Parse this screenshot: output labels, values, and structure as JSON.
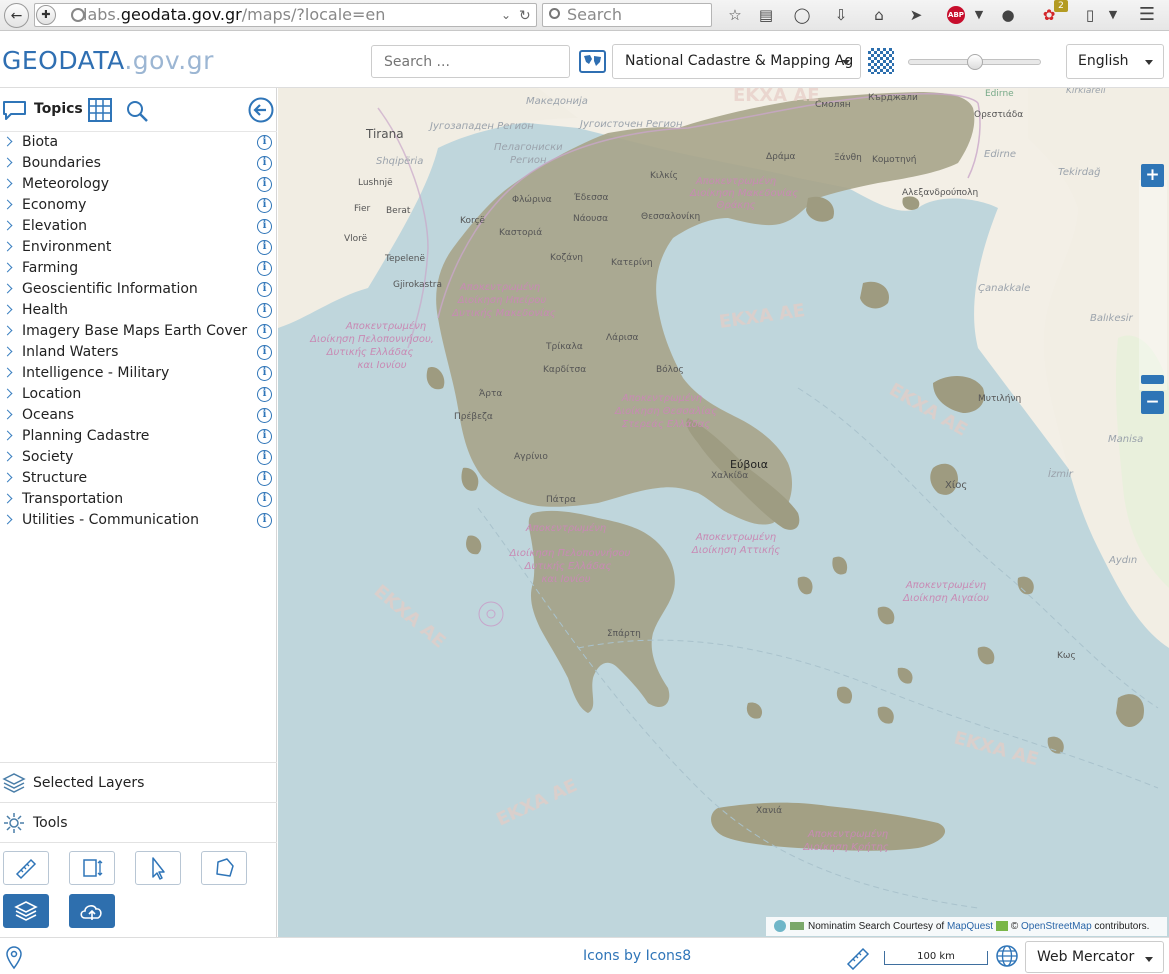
{
  "browser": {
    "url_prefix": "labs.",
    "url_domain": "geodata.gov.gr",
    "url_path": "/maps/?locale=en",
    "search_placeholder": "Search",
    "addon_badge": "2",
    "abp_label": "ABP"
  },
  "header": {
    "logo_brand": "GEODATA",
    "logo_suffix": ".gov.gr",
    "search_placeholder": "Search ...",
    "provider_selected": "National Cadastre & Mapping Ag",
    "opacity_percent": 50,
    "language_selected": "English"
  },
  "sidebar": {
    "title": "Topics",
    "topics": [
      {
        "label": "Biota"
      },
      {
        "label": "Boundaries"
      },
      {
        "label": "Meteorology"
      },
      {
        "label": "Economy"
      },
      {
        "label": "Elevation"
      },
      {
        "label": "Environment"
      },
      {
        "label": "Farming"
      },
      {
        "label": "Geoscientific Information"
      },
      {
        "label": "Health"
      },
      {
        "label": "Imagery Base Maps Earth Cover"
      },
      {
        "label": "Inland Waters"
      },
      {
        "label": "Intelligence - Military"
      },
      {
        "label": "Location"
      },
      {
        "label": "Oceans"
      },
      {
        "label": "Planning Cadastre"
      },
      {
        "label": "Society"
      },
      {
        "label": "Structure"
      },
      {
        "label": "Transportation"
      },
      {
        "label": "Utilities - Communication"
      }
    ],
    "selected_layers_label": "Selected Layers",
    "tools_label": "Tools"
  },
  "map": {
    "zoom_in": "+",
    "zoom_out": "−",
    "labels": {
      "tirana": "Tirana",
      "edirne": "Edirne",
      "tekirdag": "Tekirdağ",
      "canakkale": "Çanakkale",
      "balikesir": "Balıkesir",
      "manisa": "Manisa",
      "izmir": "İzmir",
      "aydin": "Aydın",
      "kirklareli": "Kırklareli",
      "shqiperia": "Shqipëria",
      "lushnje": "Lushnjë",
      "fier": "Fier",
      "berat": "Berat",
      "vlore": "Vlorë",
      "korce": "Korçë",
      "tepelene": "Tepelenë",
      "gjirokastra": "Gjirokastra",
      "makedonija": "Македонија",
      "jugozapaden": "Југозападен Регион",
      "jugoistochen": "Југоисточен Регион",
      "pelagoniski": "Пелагониски",
      "region": "Регион",
      "smolyan": "Смолян",
      "kardzhali": "Кърджали",
      "orestiada": "Ορεστιάδα",
      "drama": "Δράμα",
      "xanthi": "Ξάνθη",
      "komotini": "Κομοτηνή",
      "alexandroupoli": "Αλεξανδρούπολη",
      "kilkis": "Κιλκίς",
      "florina": "Φλώρινα",
      "edessa": "Έδεσσα",
      "naousa": "Νάουσα",
      "thessaloniki": "Θεσσαλονίκη",
      "kastoria": "Καστοριά",
      "kozani": "Κοζάνη",
      "katerini": "Κατερίνη",
      "larisa": "Λάρισα",
      "trikala": "Τρίκαλα",
      "karditsa": "Καρδίτσα",
      "volos": "Βόλος",
      "arta": "Άρτα",
      "preveza": "Πρέβεζα",
      "agrinio": "Αγρίνιο",
      "evvoia": "Εύβοια",
      "chalkida": "Χαλκίδα",
      "patra": "Πάτρα",
      "sparti": "Σπάρτη",
      "mytilini": "Μυτιλήνη",
      "chios": "Χίος",
      "kos": "Κως",
      "chania": "Χανιά",
      "adm_makedonia_1": "Αποκεντρωμένη",
      "adm_makedonia_2": "Διοίκηση Μακεδονίας",
      "adm_makedonia_3": "Θράκης",
      "adm_ipeirou_1": "Αποκεντρωμένη",
      "adm_ipeirou_2": "Διοίκηση Ηπείρου",
      "adm_ipeirou_3": "Δυτικής Μακεδονίας",
      "adm_ionion_1": "Αποκεντρωμένη",
      "adm_ionion_2": "Διοίκηση Πελοποννήσου,",
      "adm_ionion_3": "Δυτικής Ελλάδας",
      "adm_ionion_4": "και Ιονίου",
      "adm_thessalias_1": "Αποκεντρωμένη",
      "adm_thessalias_2": "Διοίκηση Θεσσαλίας",
      "adm_thessalias_3": "Στερεάς Ελλάδας",
      "adm_pelop_1": "Αποκεντρωμένη",
      "adm_pelop_2": "Διοίκηση Πελοποννήσου",
      "adm_pelop_3": "Δυτικής Ελλάδας",
      "adm_pelop_4": "και Ιονίου",
      "adm_attikis_1": "Αποκεντρωμένη",
      "adm_attikis_2": "Διοίκηση Αττικής",
      "adm_aigaiou_1": "Αποκεντρωμένη",
      "adm_aigaiou_2": "Διοίκηση Αιγαίου",
      "adm_kritis_1": "Αποκεντρωμένη",
      "adm_kritis_2": "Διοίκηση Κρήτης",
      "watermark": "ΕΚΧΑ ΑΕ"
    },
    "attribution_prefix": "Nominatim Search Courtesy of ",
    "attribution_mapquest": "MapQuest",
    "attribution_copy": " © ",
    "attribution_osm": "OpenStreetMap",
    "attribution_suffix": " contributors."
  },
  "footer": {
    "icons_credit": "Icons by Icons8",
    "scale_label": "100 km",
    "projection_selected": "Web Mercator"
  }
}
